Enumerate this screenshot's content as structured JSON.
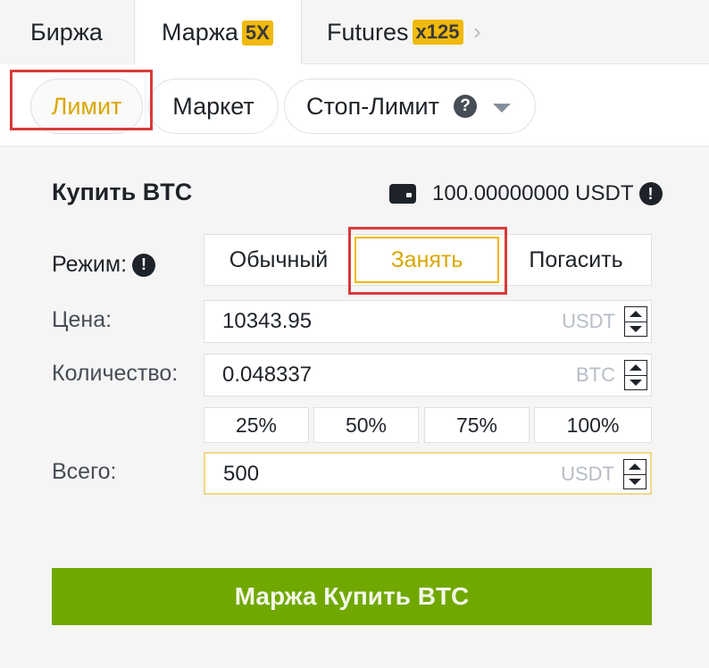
{
  "tabs": {
    "exchange": "Биржа",
    "margin": "Маржа",
    "margin_badge": "5X",
    "futures": "Futures",
    "futures_badge": "x125"
  },
  "order_types": {
    "limit": "Лимит",
    "market": "Маркет",
    "stop_limit": "Стоп-Лимит"
  },
  "form": {
    "title": "Купить BTC",
    "balance": "100.00000000 USDT",
    "mode_label": "Режим:",
    "modes": [
      "Обычный",
      "Занять",
      "Погасить"
    ],
    "selected_mode": "Занять",
    "price_label": "Цена:",
    "price_value": "10343.95",
    "price_unit": "USDT",
    "amount_label": "Количество:",
    "amount_value": "0.048337",
    "amount_unit": "BTC",
    "percentages": [
      "25%",
      "50%",
      "75%",
      "100%"
    ],
    "total_label": "Всего:",
    "total_value": "500",
    "total_unit": "USDT",
    "submit": "Маржа Купить BTC"
  },
  "colors": {
    "accent": "#f0b90b",
    "buy": "#70a800",
    "highlight": "#d93a3a"
  }
}
